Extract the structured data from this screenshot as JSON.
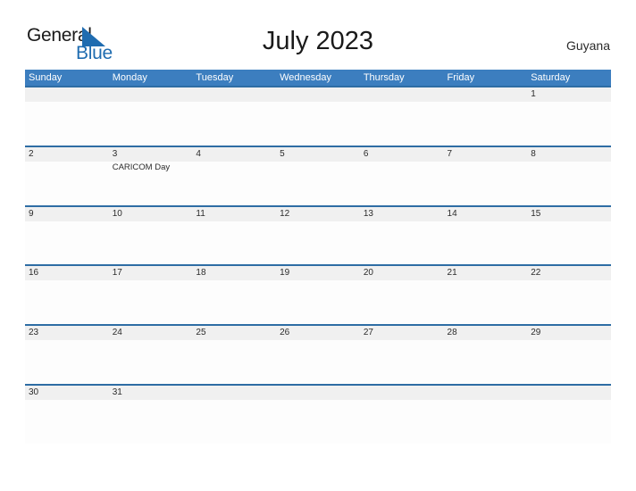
{
  "brand": {
    "name_part1": "General",
    "name_part2": "Blue",
    "triangle_icon": "blue-triangle-icon",
    "color_dark": "#1a1a1a",
    "color_blue": "#1f6cb0"
  },
  "header": {
    "title": "July 2023",
    "country": "Guyana"
  },
  "colors": {
    "header_blue": "#3c7ebf",
    "row_border_blue": "#2e6da4",
    "daynum_band_gray": "#f0f0f0",
    "text_dark": "#2b2b2b"
  },
  "calendar": {
    "day_headers": [
      "Sunday",
      "Monday",
      "Tuesday",
      "Wednesday",
      "Thursday",
      "Friday",
      "Saturday"
    ],
    "weeks": [
      {
        "days": [
          {
            "num": "",
            "events": []
          },
          {
            "num": "",
            "events": []
          },
          {
            "num": "",
            "events": []
          },
          {
            "num": "",
            "events": []
          },
          {
            "num": "",
            "events": []
          },
          {
            "num": "",
            "events": []
          },
          {
            "num": "1",
            "events": []
          }
        ]
      },
      {
        "days": [
          {
            "num": "2",
            "events": []
          },
          {
            "num": "3",
            "events": [
              "CARICOM Day"
            ]
          },
          {
            "num": "4",
            "events": []
          },
          {
            "num": "5",
            "events": []
          },
          {
            "num": "6",
            "events": []
          },
          {
            "num": "7",
            "events": []
          },
          {
            "num": "8",
            "events": []
          }
        ]
      },
      {
        "days": [
          {
            "num": "9",
            "events": []
          },
          {
            "num": "10",
            "events": []
          },
          {
            "num": "11",
            "events": []
          },
          {
            "num": "12",
            "events": []
          },
          {
            "num": "13",
            "events": []
          },
          {
            "num": "14",
            "events": []
          },
          {
            "num": "15",
            "events": []
          }
        ]
      },
      {
        "days": [
          {
            "num": "16",
            "events": []
          },
          {
            "num": "17",
            "events": []
          },
          {
            "num": "18",
            "events": []
          },
          {
            "num": "19",
            "events": []
          },
          {
            "num": "20",
            "events": []
          },
          {
            "num": "21",
            "events": []
          },
          {
            "num": "22",
            "events": []
          }
        ]
      },
      {
        "days": [
          {
            "num": "23",
            "events": []
          },
          {
            "num": "24",
            "events": []
          },
          {
            "num": "25",
            "events": []
          },
          {
            "num": "26",
            "events": []
          },
          {
            "num": "27",
            "events": []
          },
          {
            "num": "28",
            "events": []
          },
          {
            "num": "29",
            "events": []
          }
        ]
      },
      {
        "days": [
          {
            "num": "30",
            "events": []
          },
          {
            "num": "31",
            "events": []
          },
          {
            "num": "",
            "events": []
          },
          {
            "num": "",
            "events": []
          },
          {
            "num": "",
            "events": []
          },
          {
            "num": "",
            "events": []
          },
          {
            "num": "",
            "events": []
          }
        ]
      }
    ]
  }
}
